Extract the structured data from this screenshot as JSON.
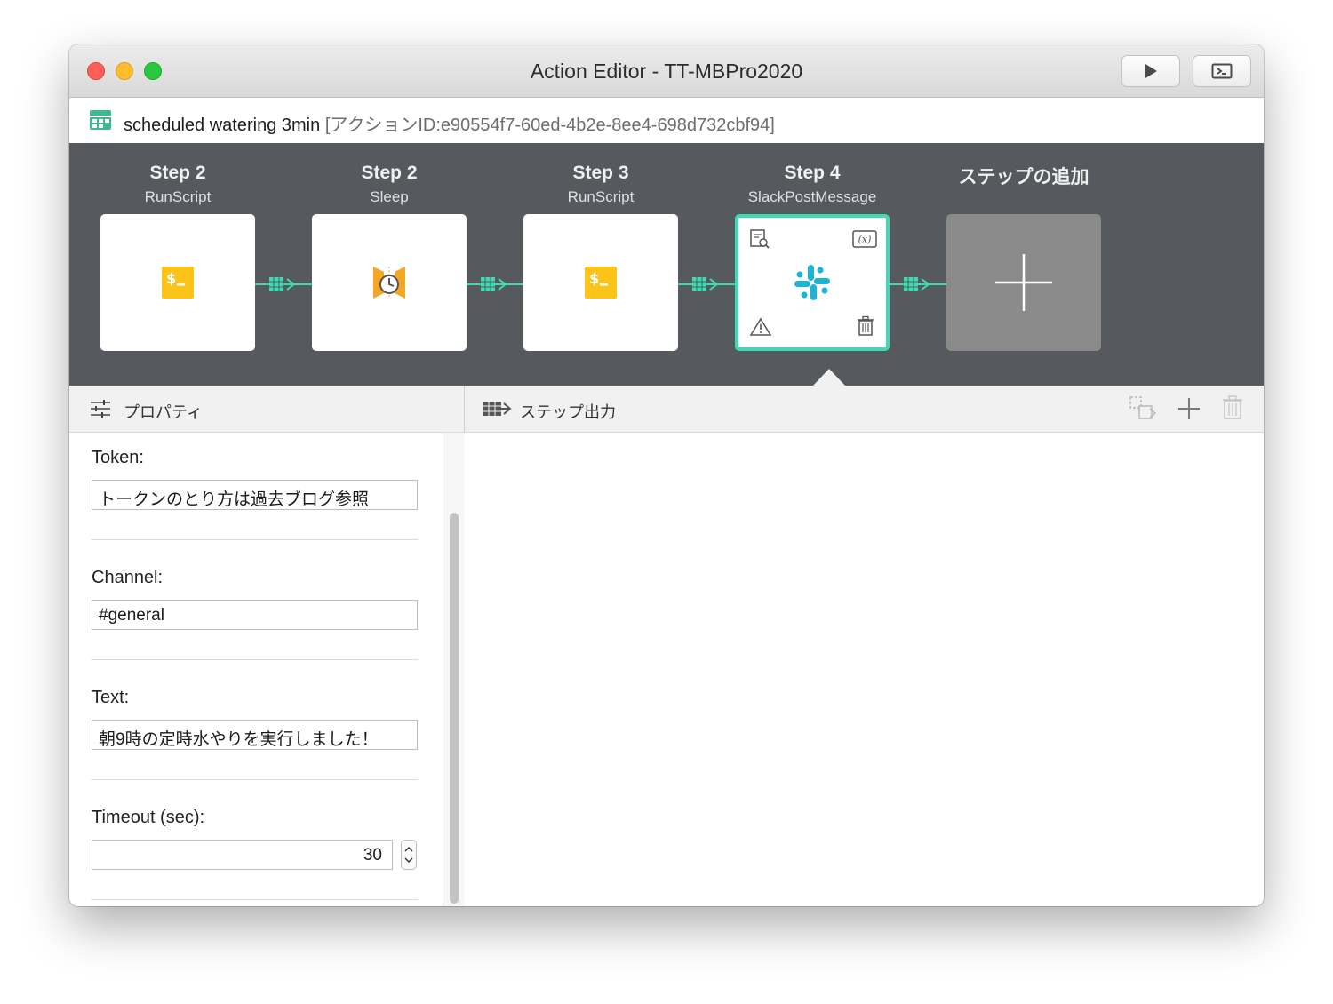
{
  "window": {
    "title": "Action Editor - TT-MBPro2020",
    "buttons": [
      {
        "name": "run",
        "icon": "play-icon"
      },
      {
        "name": "console",
        "icon": "terminal-icon"
      }
    ]
  },
  "action": {
    "name": "scheduled watering 3min",
    "id_label": "[アクションID:e90554f7-60ed-4b2e-8ee4-698d732cbf94]",
    "icon": "calendar-icon"
  },
  "steps": [
    {
      "title": "Step 2",
      "type": "RunScript",
      "icon": "terminal-script-icon"
    },
    {
      "title": "Step 2",
      "type": "Sleep",
      "icon": "sleep-clock-icon"
    },
    {
      "title": "Step 3",
      "type": "RunScript",
      "icon": "terminal-script-icon"
    },
    {
      "title": "Step 4",
      "type": "SlackPostMessage",
      "icon": "slack-icon",
      "selected": true
    },
    {
      "title": "ステップの追加",
      "type": "",
      "icon": "plus-icon"
    }
  ],
  "properties_panel": {
    "title": "プロパティ",
    "fields": [
      {
        "label": "Token:",
        "value": "トークンのとり方は過去ブログ参照"
      },
      {
        "label": "Channel:",
        "value": "#general"
      },
      {
        "label": "Text:",
        "value": "朝9時の定時水やりを実行しました！"
      },
      {
        "label": "Timeout (sec):",
        "value": "30"
      }
    ]
  },
  "output_panel": {
    "title": "ステップ出力"
  },
  "colors": {
    "accent": "#3ddbb3",
    "steps_background": "#56595d",
    "script_icon": "#fcc419",
    "sleep_icon": "#f5a623",
    "slack_icon": "#1cb3d4"
  }
}
